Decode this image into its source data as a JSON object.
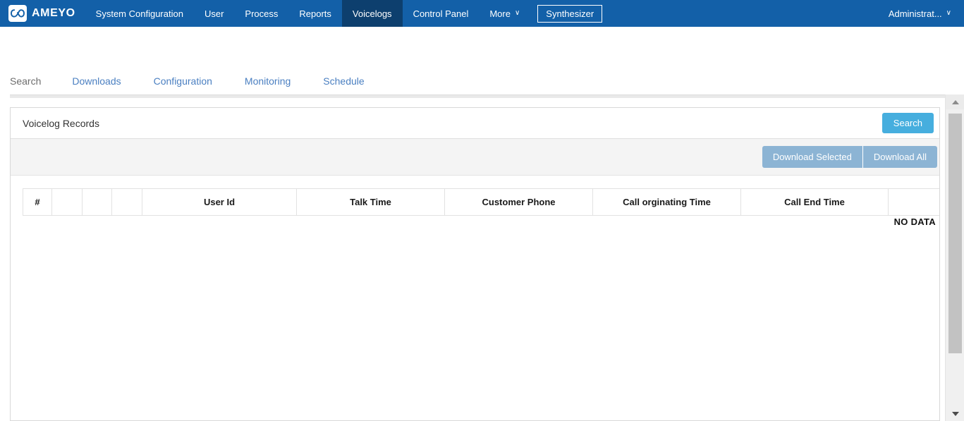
{
  "topnav": {
    "logo": {
      "text": "AMEYO",
      "icon": "infinity-icon",
      "bg": "#1360a8"
    },
    "items": [
      {
        "label": "System Configuration",
        "active": false
      },
      {
        "label": "User",
        "active": false
      },
      {
        "label": "Process",
        "active": false
      },
      {
        "label": "Reports",
        "active": false
      },
      {
        "label": "Voicelogs",
        "active": true
      },
      {
        "label": "Control Panel",
        "active": false
      },
      {
        "label": "More",
        "active": false,
        "caret": "∨"
      }
    ],
    "synthesizer_label": "Synthesizer",
    "user_label": "Administrat...",
    "user_caret": "∨",
    "active_bg": "#0d3f6e"
  },
  "subtabs": {
    "items": [
      {
        "label": "Search",
        "current": true
      },
      {
        "label": "Downloads",
        "current": false
      },
      {
        "label": "Configuration",
        "current": false
      },
      {
        "label": "Monitoring",
        "current": false
      },
      {
        "label": "Schedule",
        "current": false
      }
    ],
    "link_color": "#4a7fc1",
    "current_color": "#6d6d6d"
  },
  "panel": {
    "title": "Voicelog Records",
    "search_label": "Search",
    "search_color": "#46aede",
    "toolbar": {
      "download_selected_label": "Download Selected",
      "download_all_label": "Download All",
      "button_color": "#8cb4d4"
    },
    "table": {
      "columns": [
        "#",
        "",
        "",
        "",
        "User Id",
        "Talk Time",
        "Customer Phone",
        "Call orginating Time",
        "Call End Time",
        ""
      ],
      "rows": [],
      "empty_message": "NO DATA"
    }
  },
  "scrollbar": {
    "up_icon": "triangle-up-icon",
    "down_icon": "triangle-down-icon",
    "thumb_color": "#c2c2c2"
  }
}
